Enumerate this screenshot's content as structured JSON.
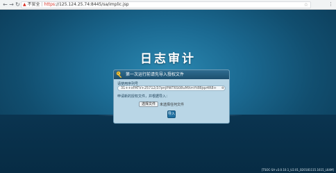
{
  "browser": {
    "address": {
      "security_label": "不安全",
      "protocol": "https",
      "url_rest": "://125.124.25.74:8445/sa/implic.jsp"
    },
    "icons": {
      "back": "back-arrow-icon",
      "forward": "forward-arrow-icon",
      "reload": "reload-icon",
      "warning": "warning-icon",
      "star": "star-icon",
      "menu": "menu-icon"
    }
  },
  "page": {
    "title": "日志审计"
  },
  "license_panel": {
    "header": "第一次运行前请先导入授权文件",
    "serial_label": "请使用序列号",
    "serial_value": "31++xFATV+25712/37pnJPWT6S08uMXmYt8Bjqz4R8+",
    "file_label": "申请新的授权文件，并根据导入：",
    "file_button": "选择文件",
    "file_status": "未选择任何文件",
    "import_button": "导入"
  },
  "footer": {
    "version": "[TSOC-SA v3.0.10.1_U2.01_B20181115.1615_L64M]"
  },
  "colors": {
    "background": "#1b6a92",
    "panel": "#b9d6e6",
    "header": "#1d4f6e",
    "accent": "#1f6fa0"
  }
}
